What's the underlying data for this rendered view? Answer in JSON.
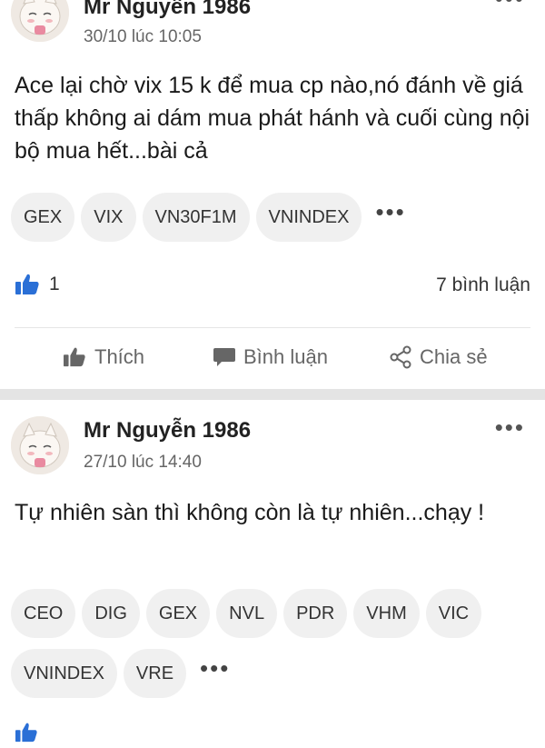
{
  "posts": [
    {
      "author": "Mr Nguyễn 1986",
      "time": "30/10 lúc 10:05",
      "more": "•••",
      "content": "Ace lại chờ vix 15 k để mua cp nào,nó đánh về giá thấp không ai dám mua phát hánh và cuối cùng nội bộ mua hết...bài cả",
      "tags": [
        "GEX",
        "VIX",
        "VN30F1M",
        "VNINDEX"
      ],
      "tags_more": "•••",
      "likes": "1",
      "comments": "7 bình luận",
      "actions": {
        "like": "Thích",
        "comment": "Bình luận",
        "share": "Chia sẻ"
      }
    },
    {
      "author": "Mr Nguyễn 1986",
      "time": "27/10 lúc 14:40",
      "more": "•••",
      "content": "Tự nhiên sàn thì không còn là tự nhiên...chạy !",
      "tags": [
        "CEO",
        "DIG",
        "GEX",
        "NVL",
        "PDR",
        "VHM",
        "VIC",
        "VNINDEX",
        "VRE"
      ],
      "tags_more": "•••"
    }
  ],
  "colors": {
    "like_blue": "#2a6fd6",
    "icon_gray": "#666666",
    "separator": "#e4e4e4"
  },
  "icons": [
    "thumbs-up-icon",
    "comment-icon",
    "share-icon",
    "more-icon"
  ]
}
